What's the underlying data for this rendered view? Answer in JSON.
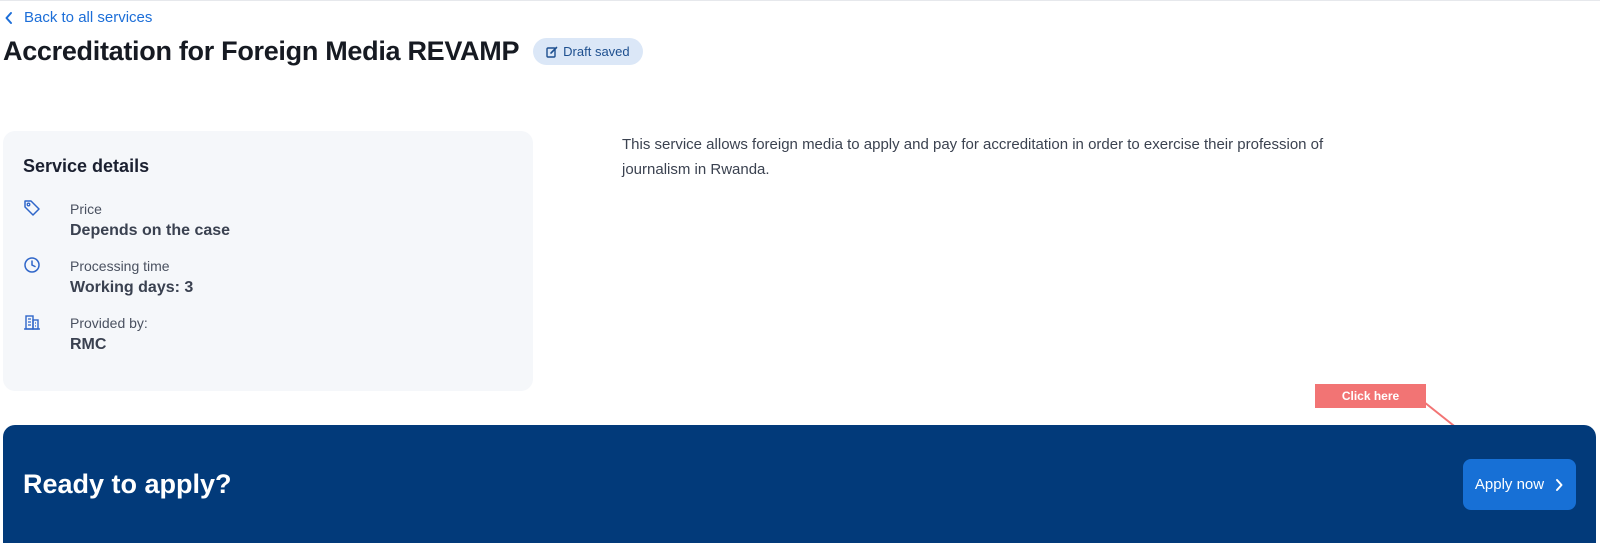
{
  "nav": {
    "back_label": "Back to all services"
  },
  "header": {
    "title": "Accreditation for Foreign Media REVAMP",
    "badge": "Draft saved"
  },
  "service_details": {
    "title": "Service details",
    "items": [
      {
        "icon": "price-tag-icon",
        "label": "Price",
        "value": "Depends on the case"
      },
      {
        "icon": "clock-icon",
        "label": "Processing time",
        "value": "Working days: 3"
      },
      {
        "icon": "building-icon",
        "label": "Provided by:",
        "value": "RMC"
      }
    ]
  },
  "description": "This service allows foreign media to apply and pay for accreditation in order to exercise their profession of journalism in Rwanda.",
  "annotation": {
    "label": "Click here",
    "color": "#f27474"
  },
  "cta": {
    "heading": "Ready to apply?",
    "button_label": "Apply now"
  },
  "colors": {
    "accent": "#1770d6",
    "banner": "#023a7a",
    "link": "#1c6ed8",
    "badge_bg": "#dbe7f7",
    "card_bg": "#f5f7fa"
  }
}
